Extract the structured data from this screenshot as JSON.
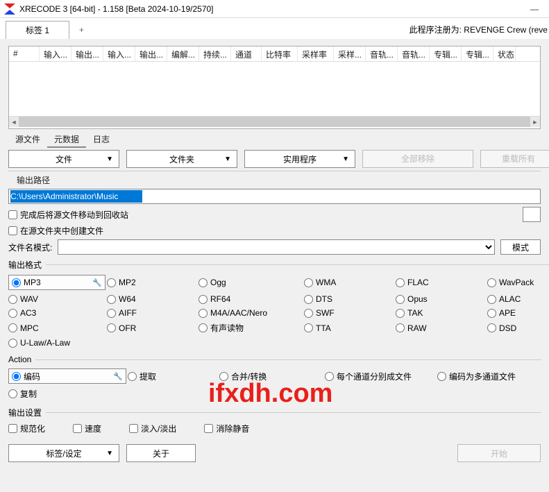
{
  "window": {
    "title": "XRECODE 3 [64-bit] - 1.158 [Beta 2024-10-19/2570]"
  },
  "tabs": {
    "main": "标签 1",
    "add": "+"
  },
  "registration": "此程序注册为: REVENGE Crew (reve",
  "columns": [
    "#",
    "输入...",
    "输出...",
    "输入...",
    "输出...",
    "编解...",
    "持续...",
    "通道",
    "比特率",
    "采样率",
    "采样...",
    "音轨...",
    "音轨...",
    "专辑...",
    "专辑...",
    "状态"
  ],
  "subtabs": {
    "source": "源文件",
    "metadata": "元数据",
    "log": "日志"
  },
  "toolbar": {
    "file": "文件",
    "folder": "文件夹",
    "utility": "实用程序",
    "remove_all": "全部移除",
    "reload_all": "重载所有"
  },
  "output": {
    "label": "输出路径",
    "path": "C:\\Users\\Administrator\\Music",
    "chk_recycle": "完成后将源文件移动到回收站",
    "chk_in_src": "在源文件夹中创建文件",
    "mode_label": "文件名模式:",
    "mode_btn": "模式",
    "dots_btn": "…"
  },
  "formats": {
    "label": "输出格式",
    "items": [
      "MP3",
      "MP2",
      "Ogg",
      "WMA",
      "FLAC",
      "WavPack",
      "WAV",
      "W64",
      "RF64",
      "DTS",
      "Opus",
      "ALAC",
      "AC3",
      "AIFF",
      "M4A/AAC/Nero",
      "SWF",
      "TAK",
      "APE",
      "MPC",
      "OFR",
      "有声读物",
      "TTA",
      "RAW",
      "DSD",
      "U-Law/A-Law"
    ],
    "selected": "MP3"
  },
  "action": {
    "label": "Action",
    "items": [
      "编码",
      "提取",
      "合并/转换",
      "每个通道分别成文件",
      "编码为多通道文件",
      "复制"
    ],
    "selected": "编码"
  },
  "outset": {
    "label": "输出设置",
    "items": [
      "规范化",
      "速度",
      "淡入/淡出",
      "消除静音"
    ]
  },
  "bottom": {
    "tags": "标签/设定",
    "about": "关于",
    "start": "开始"
  },
  "watermark": "ifxdh.com"
}
